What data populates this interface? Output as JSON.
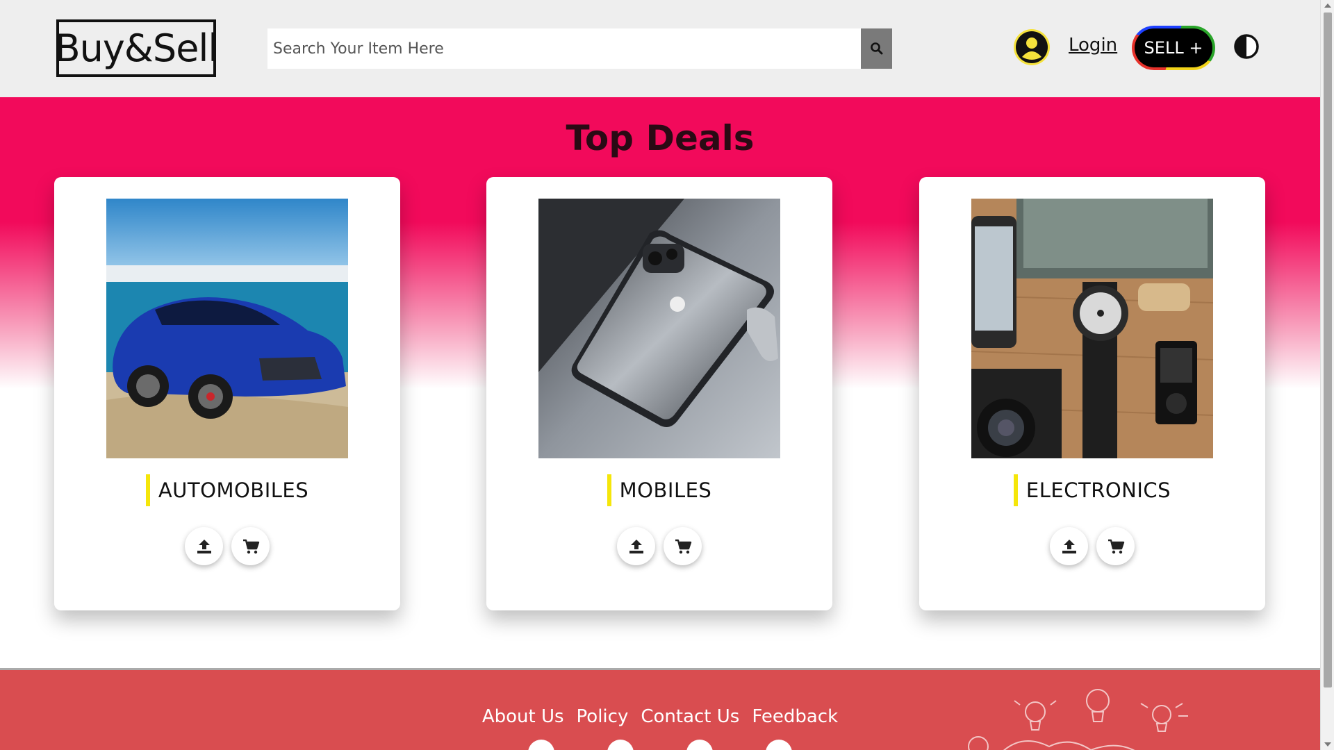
{
  "header": {
    "logo_text": "Buy&Sell",
    "search_placeholder": "Search Your Item Here",
    "search_icon": "search-icon",
    "avatar_icon": "user-avatar-icon",
    "login_label": "Login",
    "sell_label": "SELL +",
    "theme_icon": "contrast-icon"
  },
  "deals": {
    "title": "Top Deals",
    "cards": [
      {
        "label": "AUTOMOBILES",
        "image": "blue sedan car on beach",
        "upload_icon": "upload-icon",
        "cart_icon": "cart-icon"
      },
      {
        "label": "MOBILES",
        "image": "smartphone on table",
        "upload_icon": "upload-icon",
        "cart_icon": "cart-icon"
      },
      {
        "label": "ELECTRONICS",
        "image": "gadgets on wooden table",
        "upload_icon": "upload-icon",
        "cart_icon": "cart-icon"
      }
    ]
  },
  "footer": {
    "links": [
      "About Us",
      "Policy",
      "Contact Us",
      "Feedback"
    ],
    "social_icons": [
      "facebook-icon",
      "instagram-icon",
      "twitter-icon",
      "telegram-icon"
    ]
  },
  "colors": {
    "hero_pink": "#f20a5b",
    "footer_red": "#d94d50",
    "accent_yellow": "#f5e60a",
    "header_bg": "#eeeeee"
  }
}
